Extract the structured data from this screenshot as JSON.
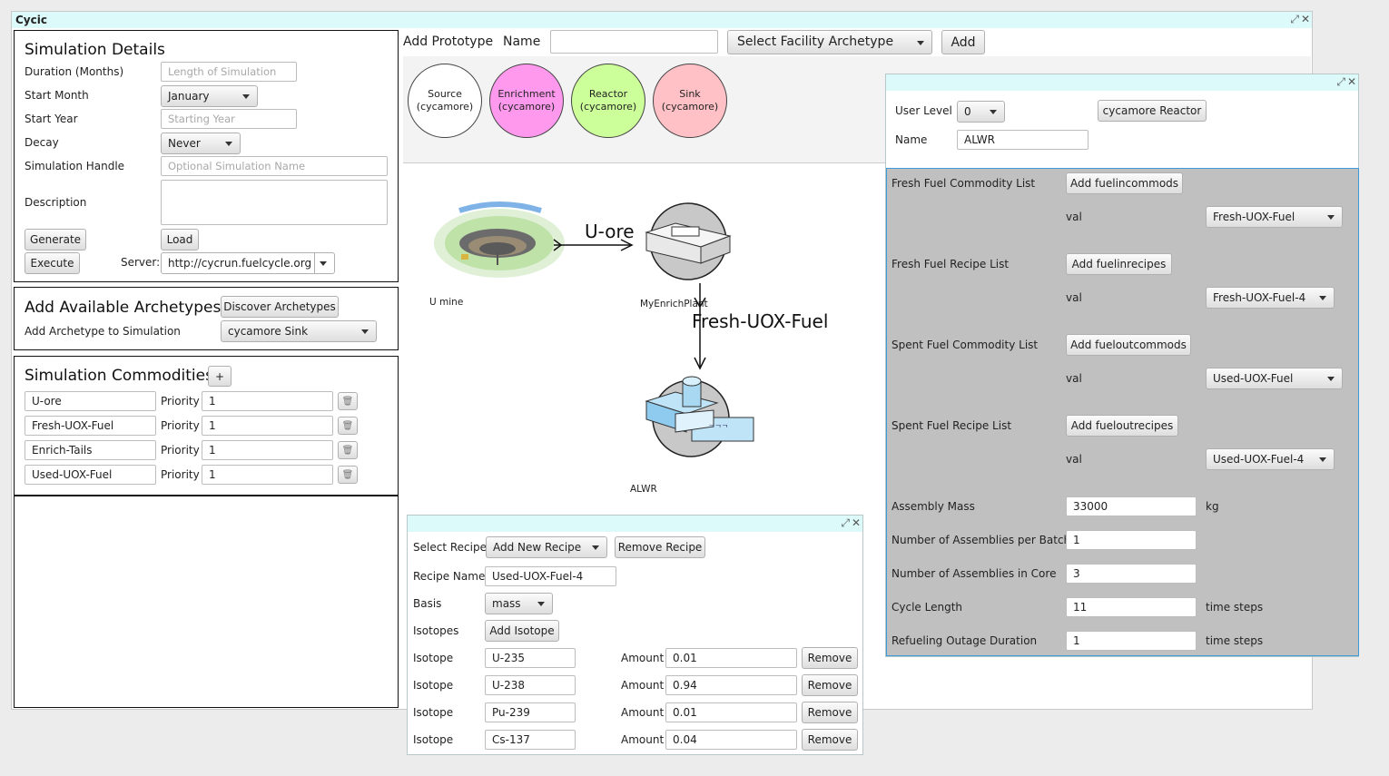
{
  "window": {
    "title": "Cycic",
    "maximize_glyph": "⤢",
    "close_glyph": "✕"
  },
  "sim": {
    "header": "Simulation Details",
    "duration_label": "Duration (Months)",
    "duration_placeholder": "Length of Simulation",
    "start_month_label": "Start Month",
    "start_month_value": "January",
    "start_year_label": "Start Year",
    "start_year_placeholder": "Starting Year",
    "decay_label": "Decay",
    "decay_value": "Never",
    "handle_label": "Simulation Handle",
    "handle_placeholder": "Optional Simulation Name",
    "description_label": "Description",
    "generate": "Generate",
    "load": "Load",
    "execute": "Execute",
    "server_label": "Server:",
    "server_value": "http://cycrun.fuelcycle.org"
  },
  "arch": {
    "header": "Add Available Archetypes",
    "discover": "Discover Archetypes",
    "add_label": "Add Archetype to Simulation",
    "selected": "cycamore Sink"
  },
  "commodities": {
    "header": "Simulation Commodities",
    "add": "+",
    "priority_label": "Priority",
    "delete_glyph": "🗑",
    "items": [
      {
        "name": "U-ore",
        "priority": "1"
      },
      {
        "name": "Fresh-UOX-Fuel",
        "priority": "1"
      },
      {
        "name": "Enrich-Tails",
        "priority": "1"
      },
      {
        "name": "Used-UOX-Fuel",
        "priority": "1"
      }
    ]
  },
  "proto": {
    "add_label": "Add Prototype",
    "name_label": "Name",
    "name_value": "",
    "archetype_select": "Select Facility Archetype",
    "add_button": "Add",
    "circles": [
      {
        "line1": "Source",
        "line2": "(cycamore)",
        "color": "#ffffff"
      },
      {
        "line1": "Enrichment",
        "line2": "(cycamore)",
        "color": "#ff99ee"
      },
      {
        "line1": "Reactor",
        "line2": "(cycamore)",
        "color": "#ccff99"
      },
      {
        "line1": "Sink",
        "line2": "(cycamore)",
        "color": "#ffc0c6"
      }
    ]
  },
  "graph": {
    "nodes": {
      "mine": "U mine",
      "enrich": "MyEnrichPlant",
      "reactor": "ALWR"
    },
    "edges": {
      "e1": "U-ore",
      "e2": "Fresh-UOX-Fuel"
    }
  },
  "recipe": {
    "select_label": "Select Recipe",
    "select_value": "Add New Recipe",
    "remove_recipe": "Remove Recipe",
    "name_label": "Recipe Name",
    "name_value": "Used-UOX-Fuel-4",
    "basis_label": "Basis",
    "basis_value": "mass",
    "isotopes_label": "Isotopes",
    "add_isotope": "Add Isotope",
    "isotope_label": "Isotope",
    "amount_label": "Amount",
    "remove": "Remove",
    "rows": [
      {
        "isotope": "U-235",
        "amount": "0.01"
      },
      {
        "isotope": "U-238",
        "amount": "0.94"
      },
      {
        "isotope": "Pu-239",
        "amount": "0.01"
      },
      {
        "isotope": "Cs-137",
        "amount": "0.04"
      }
    ]
  },
  "reactor": {
    "user_level_label": "User Level",
    "user_level_value": "0",
    "archetype_button": "cycamore Reactor",
    "name_label": "Name",
    "name_value": "ALWR",
    "val_label": "val",
    "lists": [
      {
        "label": "Fresh Fuel Commodity List",
        "button": "Add fuelincommods",
        "val": "Fresh-UOX-Fuel"
      },
      {
        "label": "Fresh Fuel Recipe List",
        "button": "Add fuelinrecipes",
        "val": "Fresh-UOX-Fuel-4"
      },
      {
        "label": "Spent Fuel Commodity List",
        "button": "Add fueloutcommods",
        "val": "Used-UOX-Fuel"
      },
      {
        "label": "Spent Fuel Recipe List",
        "button": "Add fueloutrecipes",
        "val": "Used-UOX-Fuel-4"
      }
    ],
    "params": [
      {
        "label": "Assembly Mass",
        "value": "33000",
        "unit": "kg"
      },
      {
        "label": "Number of Assemblies per Batch",
        "value": "1",
        "unit": ""
      },
      {
        "label": "Number of Assemblies in Core",
        "value": "3",
        "unit": ""
      },
      {
        "label": "Cycle Length",
        "value": "11",
        "unit": "time steps"
      },
      {
        "label": "Refueling Outage Duration",
        "value": "1",
        "unit": "time steps"
      }
    ]
  }
}
